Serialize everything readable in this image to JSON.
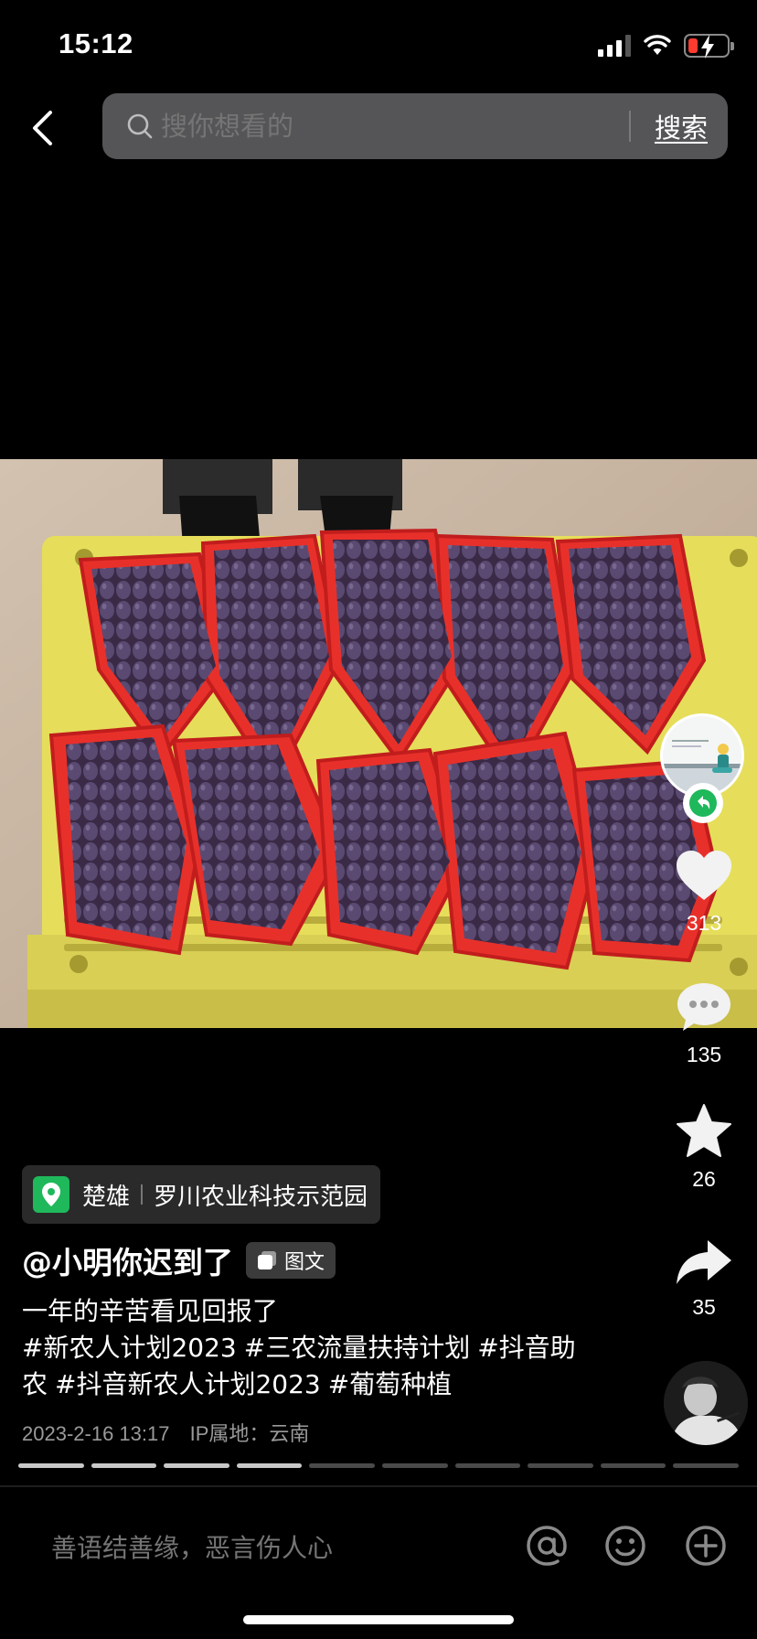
{
  "status_bar": {
    "time": "15:12",
    "battery_color": "#ff3b30"
  },
  "header": {
    "back_icon": "chevron-left-icon",
    "search_placeholder": "搜你想看的",
    "search_button": "搜索"
  },
  "post": {
    "image_subject": "grape-bunches-photo",
    "location": {
      "city": "楚雄",
      "place": "罗川农业科技示范园",
      "pin_color": "#1fb85b"
    },
    "author": "@小明你迟到了",
    "type_badge": "图文",
    "caption_text": "一年的辛苦看见回报了",
    "hashtags": [
      "#新农人计划2023",
      "#三农流量扶持计划",
      "#抖音助农",
      "#抖音新农人计划2023",
      "#葡萄种植"
    ],
    "date": "2023-2-16 13:17",
    "ip_location": "IP属地：云南",
    "image_progress": {
      "current": 4,
      "total": 10
    }
  },
  "actions": {
    "likes": "313",
    "comments": "135",
    "favorites": "26",
    "shares": "35"
  },
  "comment_bar": {
    "placeholder": "善语结善缘，恶言伤人心",
    "icons": [
      "at-icon",
      "emoji-icon",
      "add-icon"
    ]
  }
}
